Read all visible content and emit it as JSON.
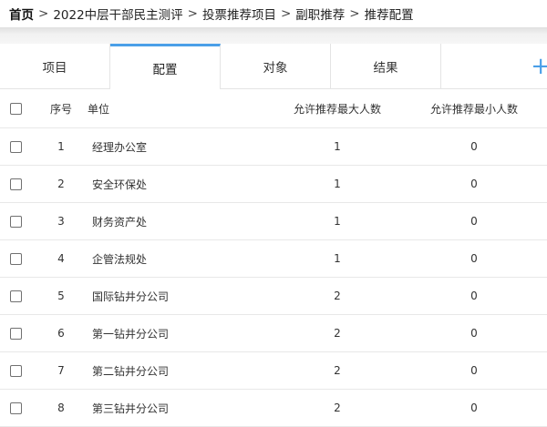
{
  "breadcrumb": {
    "items": [
      "首页",
      "2022中层干部民主测评",
      "投票推荐项目",
      "副职推荐",
      "推荐配置"
    ],
    "separator": ">"
  },
  "tabs": [
    {
      "label": "项目",
      "active": false
    },
    {
      "label": "配置",
      "active": true
    },
    {
      "label": "对象",
      "active": false
    },
    {
      "label": "结果",
      "active": false
    }
  ],
  "add_tab": {
    "icon": "plus-icon",
    "glyph": "+"
  },
  "colors": {
    "accent": "#4a9fe8",
    "border": "#e4e4e4"
  },
  "table": {
    "headers": {
      "index": "序号",
      "unit": "单位",
      "max": "允许推荐最大人数",
      "min": "允许推荐最小人数"
    },
    "rows": [
      {
        "index": "1",
        "unit": "经理办公室",
        "max": "1",
        "min": "0"
      },
      {
        "index": "2",
        "unit": "安全环保处",
        "max": "1",
        "min": "0"
      },
      {
        "index": "3",
        "unit": "财务资产处",
        "max": "1",
        "min": "0"
      },
      {
        "index": "4",
        "unit": "企管法规处",
        "max": "1",
        "min": "0"
      },
      {
        "index": "5",
        "unit": "国际钻井分公司",
        "max": "2",
        "min": "0"
      },
      {
        "index": "6",
        "unit": "第一钻井分公司",
        "max": "2",
        "min": "0"
      },
      {
        "index": "7",
        "unit": "第二钻井分公司",
        "max": "2",
        "min": "0"
      },
      {
        "index": "8",
        "unit": "第三钻井分公司",
        "max": "2",
        "min": "0"
      }
    ]
  }
}
